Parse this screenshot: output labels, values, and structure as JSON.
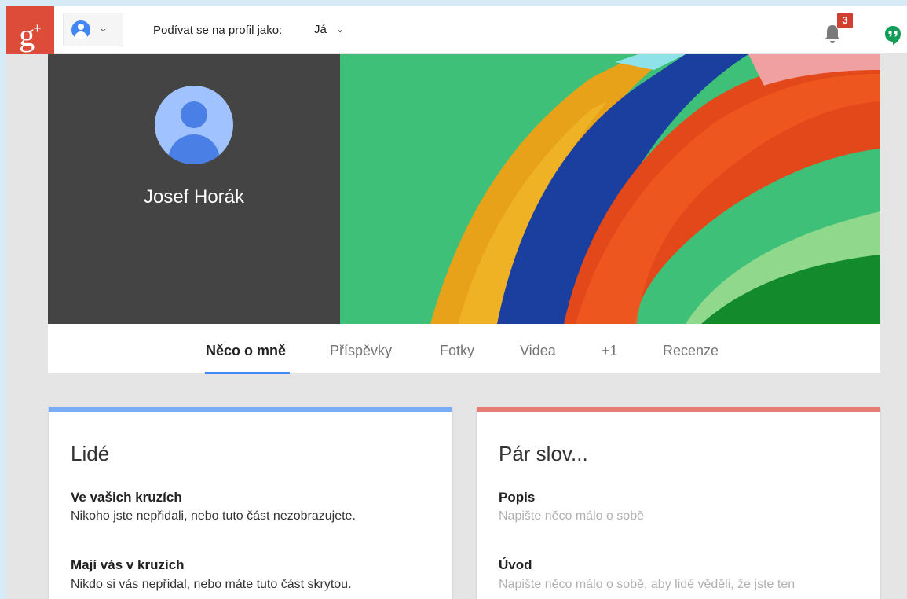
{
  "topbar": {
    "logo_text": "g",
    "logo_plus": "+",
    "account_chevron": "⌄",
    "view_as_label": "Podívat se na profil jako:",
    "view_as_value": "Já",
    "view_as_chevron": "⌄",
    "notification_count": "3",
    "icons": [
      "gplus-logo",
      "account-avatar-icon",
      "chevron-down-icon",
      "bell-icon",
      "hangouts-icon"
    ]
  },
  "profile": {
    "name": "Josef Horák"
  },
  "tabs": [
    {
      "label": "Něco o mně",
      "active": true
    },
    {
      "label": "Příspěvky",
      "active": false
    },
    {
      "label": "Fotky",
      "active": false
    },
    {
      "label": "Videa",
      "active": false
    },
    {
      "label": "+1",
      "active": false
    },
    {
      "label": "Recenze",
      "active": false
    }
  ],
  "people_card": {
    "title": "Lidé",
    "accent_color": "#7baaf7",
    "sections": [
      {
        "title": "Ve vašich kruzích",
        "text": "Nikoho jste nepřidali, nebo tuto část nezobrazujete."
      },
      {
        "title": "Mají vás v kruzích",
        "text": "Nikdo si vás nepřidal, nebo máte tuto část skrytou."
      }
    ]
  },
  "about_card": {
    "title": "Pár slov...",
    "accent_color": "#e67c73",
    "sections": [
      {
        "title": "Popis",
        "text": "Napište něco málo o sobě"
      },
      {
        "title": "Úvod",
        "text": "Napište něco málo o sobě, aby lidé věděli, že jste ten"
      }
    ]
  },
  "colors": {
    "gplus_red": "#dd4b39",
    "active_tab_underline": "#4285f4",
    "badge_red": "#d23f31",
    "hangouts_green": "#0f9d58"
  }
}
